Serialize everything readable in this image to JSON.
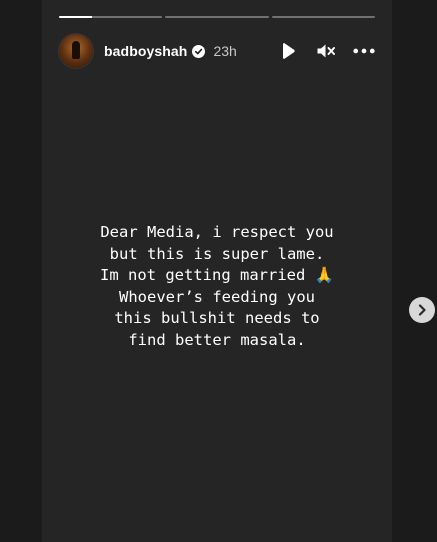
{
  "story": {
    "progress": [
      1,
      0,
      0
    ],
    "active_fill_fraction": 0.32,
    "username": "badboyshah",
    "time": "23h",
    "caption": "Dear Media, i respect you\nbut this is super lame.\nIm not getting married 🙏\nWhoever’s feeding you\nthis bullshit needs to\nfind better masala."
  },
  "icons": {
    "verified": "verified-badge-icon",
    "play": "play-icon",
    "mute": "muted-speaker-icon",
    "more": "more-options-icon",
    "next": "chevron-right-icon"
  },
  "colors": {
    "page_background": "#1b1b1b",
    "story_background": "#252525",
    "text": "#ffffff",
    "next_button": "#d8d8d8"
  }
}
